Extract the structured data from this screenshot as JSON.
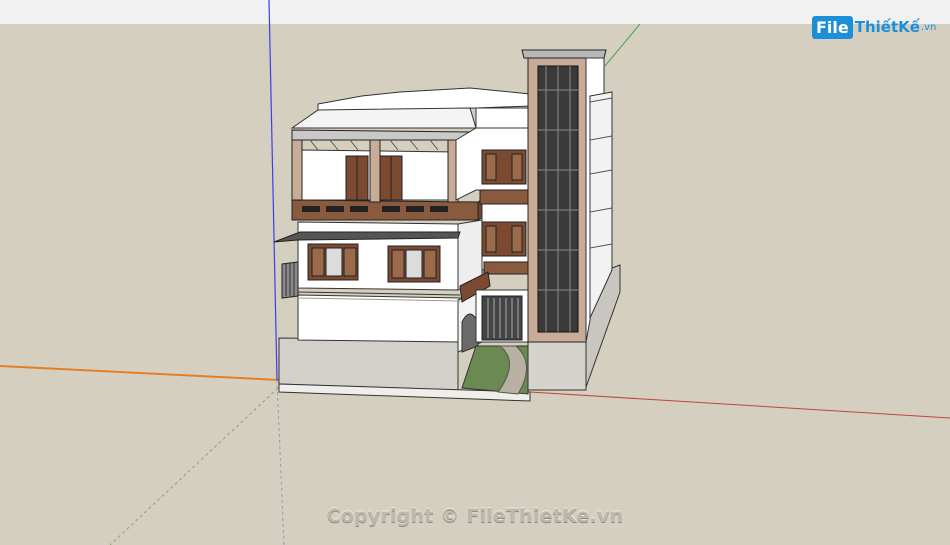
{
  "logo": {
    "prefix": "File",
    "brand": "ThiếtKế",
    "tld": ".vn"
  },
  "watermark": {
    "text": "Copyright © FileThietKe.vn"
  },
  "colors": {
    "ground": "#d4cfbf",
    "sky": "#f1f1f1",
    "x_axis": "#e27f28",
    "y_axis": "#55a14a",
    "z_axis": "#3d3df0",
    "wall": "#ffffff",
    "wood": "#7b4a30",
    "stair_tower": "#c9ac98"
  }
}
